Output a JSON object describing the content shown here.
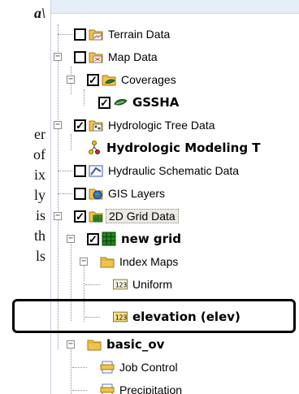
{
  "document": {
    "fragments": [
      {
        "text": "a\\",
        "italic": true
      },
      {
        "text": "er"
      },
      {
        "text": "of"
      },
      {
        "text": "ix"
      },
      {
        "text": "ly"
      },
      {
        "text": "is"
      },
      {
        "text": "th"
      },
      {
        "text": "ls"
      }
    ]
  },
  "tree": {
    "items": [
      {
        "label": "Terrain Data",
        "checked": false,
        "icon": "terrain-folder-icon"
      },
      {
        "label": "Map Data",
        "checked": false,
        "icon": "map-folder-icon"
      },
      {
        "label": "Coverages",
        "checked": true,
        "icon": "coverages-folder-icon"
      },
      {
        "label": "GSSHA",
        "checked": true,
        "icon": "coverage-icon"
      },
      {
        "label": "Hydrologic Tree Data",
        "checked": true,
        "icon": "hydrologic-tree-folder-icon"
      },
      {
        "label": "Hydrologic Modeling T",
        "icon": "hydrologic-model-icon"
      },
      {
        "label": "Hydraulic Schematic Data",
        "checked": false,
        "icon": "hydraulic-schematic-icon"
      },
      {
        "label": "GIS Layers",
        "checked": false,
        "icon": "gis-globe-icon"
      },
      {
        "label": "2D Grid Data",
        "checked": true,
        "icon": "grid-folder-icon"
      },
      {
        "label": "new grid",
        "checked": true,
        "icon": "grid-icon"
      },
      {
        "label": "Index Maps",
        "icon": "folder-icon"
      },
      {
        "label": "Uniform",
        "icon": "index-map-123-icon"
      },
      {
        "label": "elevation (elev)",
        "icon": "index-map-123-icon"
      },
      {
        "label": "basic_ov",
        "icon": "folder-icon"
      },
      {
        "label": "Job Control",
        "icon": "document-icon"
      },
      {
        "label": "Precipitation",
        "icon": "document-icon"
      }
    ]
  },
  "colors": {
    "check": "#000000",
    "folder": "#f1c24a",
    "grid_green": "#1c8a1c",
    "highlight_border": "#000000"
  }
}
